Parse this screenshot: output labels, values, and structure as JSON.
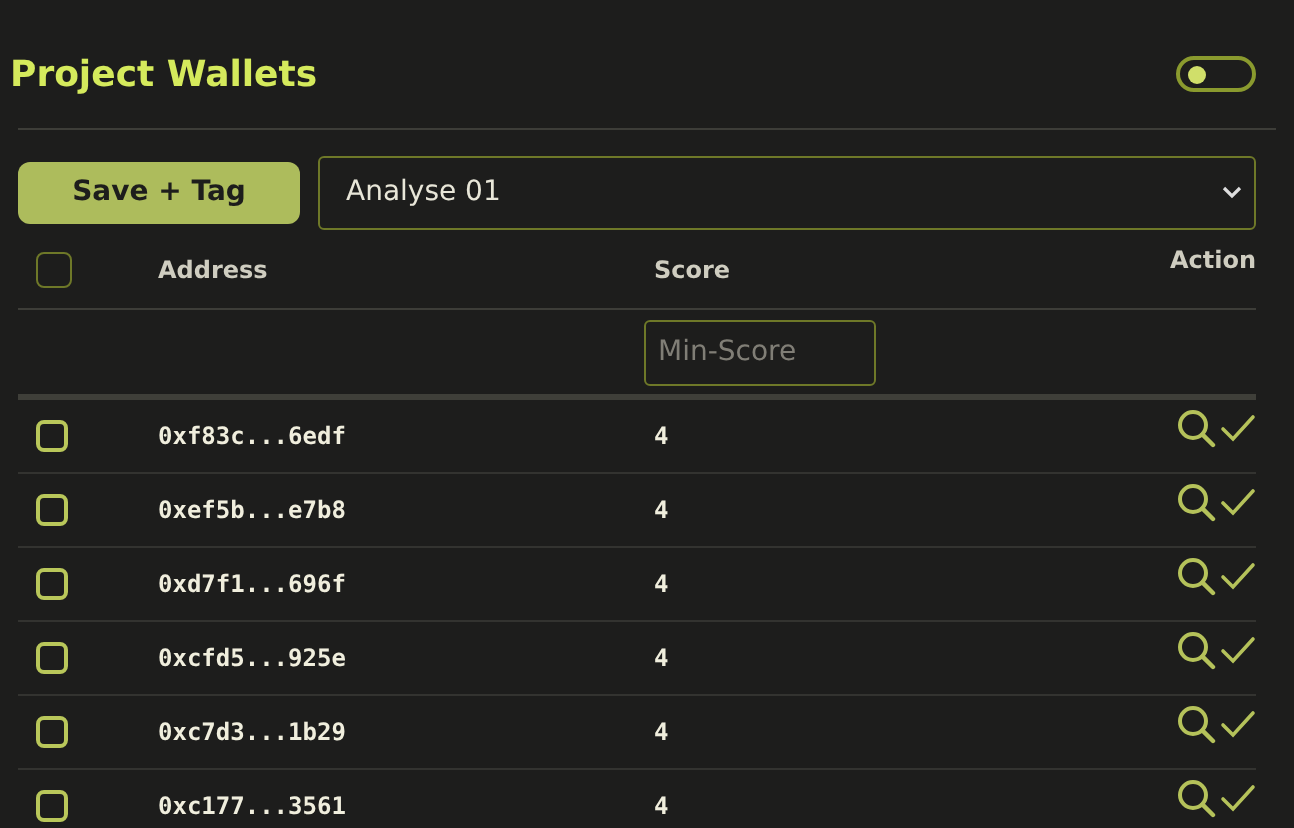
{
  "header": {
    "title": "Project Wallets",
    "toggle": {
      "on": false
    }
  },
  "toolbar": {
    "button": "Save + Tag",
    "select_value": "Analyse 01"
  },
  "table": {
    "select_all": {
      "checked": false
    },
    "columns": [
      "Address",
      "Score",
      "Action"
    ],
    "filter": {
      "placeholder": "Min-Score"
    },
    "rows": [
      {
        "address": "0xf83c...6edf",
        "score": "4",
        "checked": false
      },
      {
        "address": "0xef5b...e7b8",
        "score": "4",
        "checked": false
      },
      {
        "address": "0xd7f1...696f",
        "score": "4",
        "checked": false
      },
      {
        "address": "0xcfd5...925e",
        "score": "4",
        "checked": false
      },
      {
        "address": "0xc7d3...1b29",
        "score": "4",
        "checked": false
      },
      {
        "address": "0xc177...3561",
        "score": "4",
        "checked": false
      }
    ]
  }
}
